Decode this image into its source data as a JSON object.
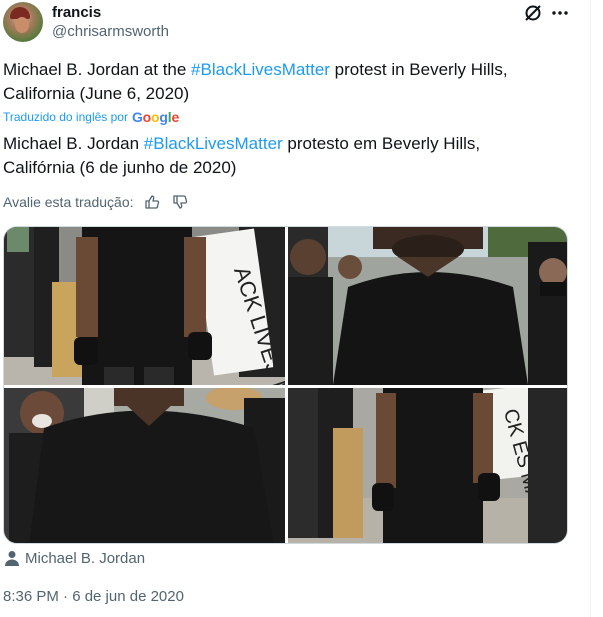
{
  "author": {
    "display_name": "francis",
    "handle": "@chrisarmsworth"
  },
  "tweet": {
    "original_text_pre": "Michael B. Jordan at the ",
    "original_hashtag": "#BlackLivesMatter",
    "original_text_post": " protest in Beverly Hills, California (June 6, 2020)",
    "translated_by_label": "Traduzido do inglês por",
    "translated_by_brand": "Google",
    "translated_text_pre": "Michael B. Jordan ",
    "translated_hashtag": "#BlackLivesMatter",
    "translated_text_post": " protesto em Beverly Hills, Califórnia (6 de junho de 2020)",
    "rate_label": "Avalie esta tradução:",
    "tagged_person": "Michael B. Jordan",
    "timestamp": "8:36 PM · 6 de jun de 2020"
  },
  "media": {
    "sign_text_1": "ACK LIVES MATTER",
    "sign_text_2": "CK ES MATTER"
  },
  "icons": {
    "grok": "grok-icon",
    "more": "more-icon",
    "thumbs_up": "thumbs-up-icon",
    "thumbs_down": "thumbs-down-icon",
    "person": "person-icon"
  },
  "colors": {
    "link": "#1d9bf0",
    "text": "#0f1419",
    "muted": "#536471"
  }
}
